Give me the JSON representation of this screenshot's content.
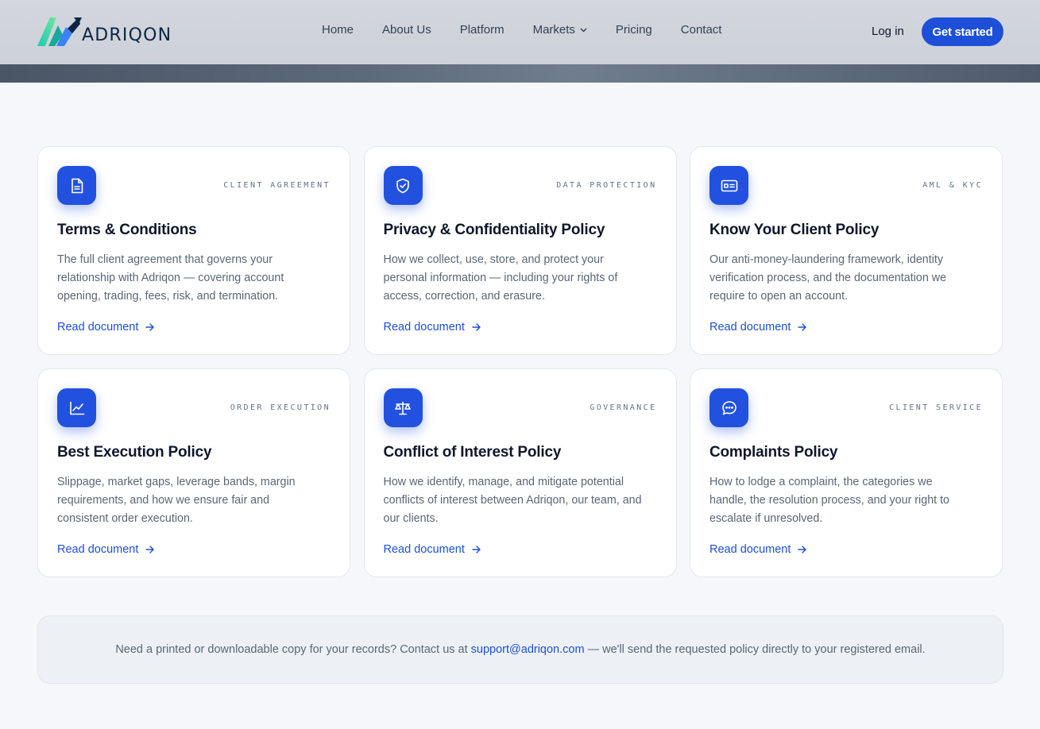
{
  "brand": {
    "name": "ADRIQON"
  },
  "nav": {
    "items": [
      {
        "label": "Home"
      },
      {
        "label": "About Us"
      },
      {
        "label": "Platform"
      },
      {
        "label": "Markets"
      },
      {
        "label": "Pricing"
      },
      {
        "label": "Contact"
      }
    ],
    "login_label": "Log in",
    "cta_label": "Get started"
  },
  "cards": [
    {
      "icon": "document-icon",
      "tag": "CLIENT AGREEMENT",
      "title": "Terms & Conditions",
      "desc": "The full client agreement that governs your relationship with Adriqon — covering account opening, trading, fees, risk, and termination.",
      "link": "Read document"
    },
    {
      "icon": "shield-check-icon",
      "tag": "DATA PROTECTION",
      "title": "Privacy & Confidentiality Policy",
      "desc": "How we collect, use, store, and protect your personal information — including your rights of access, correction, and erasure.",
      "link": "Read document"
    },
    {
      "icon": "id-card-icon",
      "tag": "AML & KYC",
      "title": "Know Your Client Policy",
      "desc": "Our anti-money-laundering framework, identity verification process, and the documentation we require to open an account.",
      "link": "Read document"
    },
    {
      "icon": "line-chart-icon",
      "tag": "ORDER EXECUTION",
      "title": "Best Execution Policy",
      "desc": "Slippage, market gaps, leverage bands, margin requirements, and how we ensure fair and consistent order execution.",
      "link": "Read document"
    },
    {
      "icon": "scales-icon",
      "tag": "GOVERNANCE",
      "title": "Conflict of Interest Policy",
      "desc": "How we identify, manage, and mitigate potential conflicts of interest between Adriqon, our team, and our clients.",
      "link": "Read document"
    },
    {
      "icon": "chat-bubble-icon",
      "tag": "CLIENT SERVICE",
      "title": "Complaints Policy",
      "desc": "How to lodge a complaint, the categories we handle, the resolution process, and your right to escalate if unresolved.",
      "link": "Read document"
    }
  ],
  "note": {
    "before": "Need a printed or downloadable copy for your records? Contact us at ",
    "email": "support@adriqon.com",
    "after": " — we'll send the requested policy directly to your registered email."
  },
  "colors": {
    "accent": "#1d4fd8",
    "icon_bg": "#2251df",
    "card_bg": "#ffffff",
    "page_bg": "#f5f7fa"
  }
}
